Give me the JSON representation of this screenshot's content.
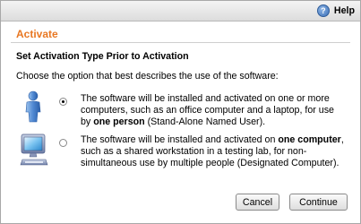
{
  "header": {
    "help_label": "Help",
    "help_icon": "help-icon"
  },
  "page": {
    "title": "Activate",
    "title_color": "#e87722",
    "section_heading": "Set Activation Type Prior to Activation",
    "instruction": "Choose the option that best describes the use of the software:"
  },
  "options": [
    {
      "icon": "person-icon",
      "selected": true,
      "text_before": "The software will be installed and activated on one or more computers, such as an office computer and a laptop, for use by ",
      "text_bold": "one person",
      "text_after": " (Stand-Alone Named User)."
    },
    {
      "icon": "computer-icon",
      "selected": false,
      "text_before": "The software will be installed and activated on ",
      "text_bold": "one computer",
      "text_after": ", such as a shared workstation in a testing lab, for non-simultaneous use by multiple people (Designated Computer)."
    }
  ],
  "buttons": {
    "cancel": "Cancel",
    "continue": "Continue"
  }
}
